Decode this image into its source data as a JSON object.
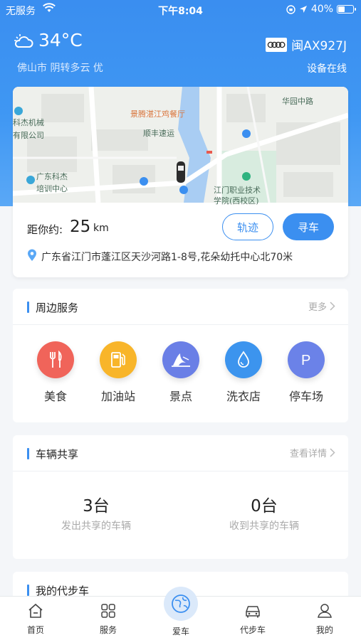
{
  "status_bar": {
    "carrier": "无服务",
    "time": "下午8:04",
    "battery": "40%"
  },
  "weather": {
    "temperature": "34°C",
    "description": "佛山市 阴转多云 优"
  },
  "vehicle": {
    "plate": "闽AX927J",
    "device_status": "设备在线"
  },
  "map": {
    "labels": [
      "景腾湛江鸡餐厅",
      "顺丰速运",
      "华园中路",
      "科杰机械",
      "有限公司",
      "广东科杰",
      "培训中心",
      "江门职业技术",
      "学院(西校区)"
    ]
  },
  "location": {
    "distance_label": "距你约:",
    "distance_value": "25",
    "distance_unit": "km",
    "track_button": "轨迹",
    "find_button": "寻车",
    "address": "广东省江门市蓬江区天沙河路1-8号,花朵幼托中心北70米"
  },
  "services": {
    "title": "周边服务",
    "more": "更多",
    "items": [
      {
        "label": "美食",
        "icon": "food-icon",
        "color": "#f0645a"
      },
      {
        "label": "加油站",
        "icon": "gas-station-icon",
        "color": "#f8b52a"
      },
      {
        "label": "景点",
        "icon": "scenic-spot-icon",
        "color": "#6a7fe6"
      },
      {
        "label": "洗衣店",
        "icon": "laundry-icon",
        "color": "#3c94ee"
      },
      {
        "label": "停车场",
        "icon": "parking-icon",
        "color": "#6b82e8"
      }
    ]
  },
  "sharing": {
    "title": "车辆共享",
    "more": "查看详情",
    "sent_count": "3台",
    "sent_label": "发出共享的车辆",
    "received_count": "0台",
    "received_label": "收到共享的车辆"
  },
  "my_car": {
    "title": "我的代步车"
  },
  "tabbar": {
    "home": "首页",
    "service": "服务",
    "car": "爱车",
    "scooter": "代步车",
    "me": "我的"
  },
  "colors": {
    "primary": "#3b8ff0"
  }
}
